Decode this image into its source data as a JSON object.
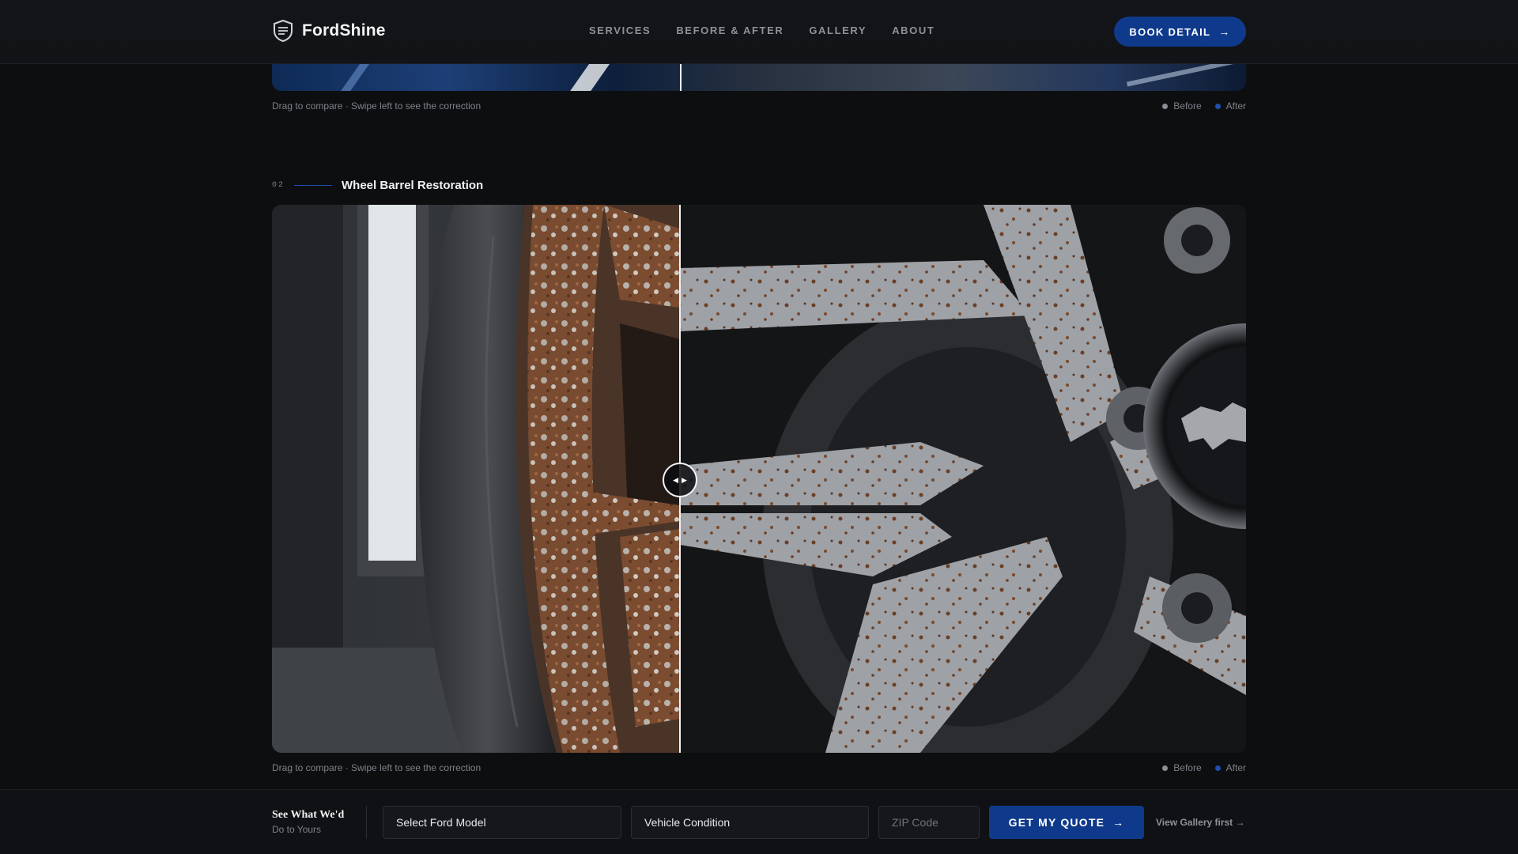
{
  "header": {
    "brand": "FordShine",
    "nav": [
      "SERVICES",
      "BEFORE & AFTER",
      "GALLERY",
      "ABOUT"
    ],
    "cta_label": "BOOK DETAIL"
  },
  "comparisons": [
    {
      "caption": "Drag to compare · Swipe left to see the correction",
      "legend_before": "Before",
      "legend_after": "After"
    },
    {
      "number": "02",
      "title": "Wheel Barrel Restoration",
      "caption": "Drag to compare · Swipe left to see the correction",
      "legend_before": "Before",
      "legend_after": "After",
      "divider_position": 0.42
    }
  ],
  "quote_bar": {
    "title": "See What We'd",
    "subtitle": "Do to Yours",
    "model_value": "Select Ford Model",
    "condition_value": "Vehicle Condition",
    "zip_placeholder": "ZIP Code",
    "submit_label": "GET MY QUOTE",
    "gallery_link": "View Gallery first"
  },
  "colors": {
    "accent": "#0f3a8c",
    "background": "#0d0e10",
    "after_dot": "#1f4fb0"
  }
}
